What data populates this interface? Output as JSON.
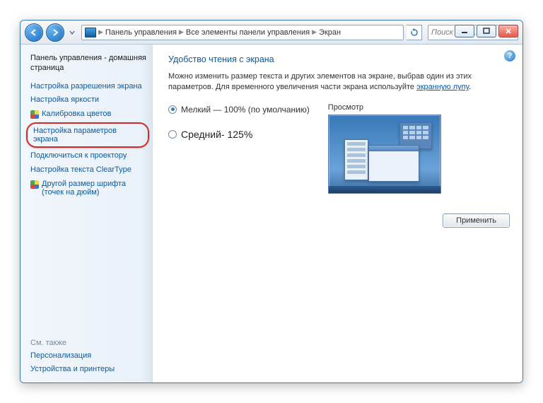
{
  "titlebar": {
    "min_tooltip": "Свернуть",
    "max_tooltip": "Развернуть",
    "close_tooltip": "Закрыть"
  },
  "breadcrumb": {
    "root": "Панель управления",
    "mid": "Все элементы панели управления",
    "leaf": "Экран"
  },
  "search": {
    "placeholder": "Поиск в па..."
  },
  "sidebar": {
    "home": "Панель управления - домашняя страница",
    "items": [
      "Настройка разрешения экрана",
      "Настройка яркости",
      "Калибровка цветов",
      "Настройка параметров экрана",
      "Подключиться к проектору",
      "Настройка текста ClearType",
      "Другой размер шрифта (точек на дюйм)"
    ],
    "see_also": "См. также",
    "footer": [
      "Персонализация",
      "Устройства и принтеры"
    ]
  },
  "content": {
    "heading": "Удобство чтения с экрана",
    "desc_pre": "Можно изменить размер текста и других элементов на экране, выбрав один из этих параметров. Для временного увеличения части экрана используйте ",
    "desc_link": "экранную лупу",
    "desc_post": ".",
    "opt_small": "Мелкий — 100% (по умолчанию)",
    "opt_medium": "Средний- 125%",
    "preview_label": "Просмотр",
    "apply": "Применить"
  }
}
